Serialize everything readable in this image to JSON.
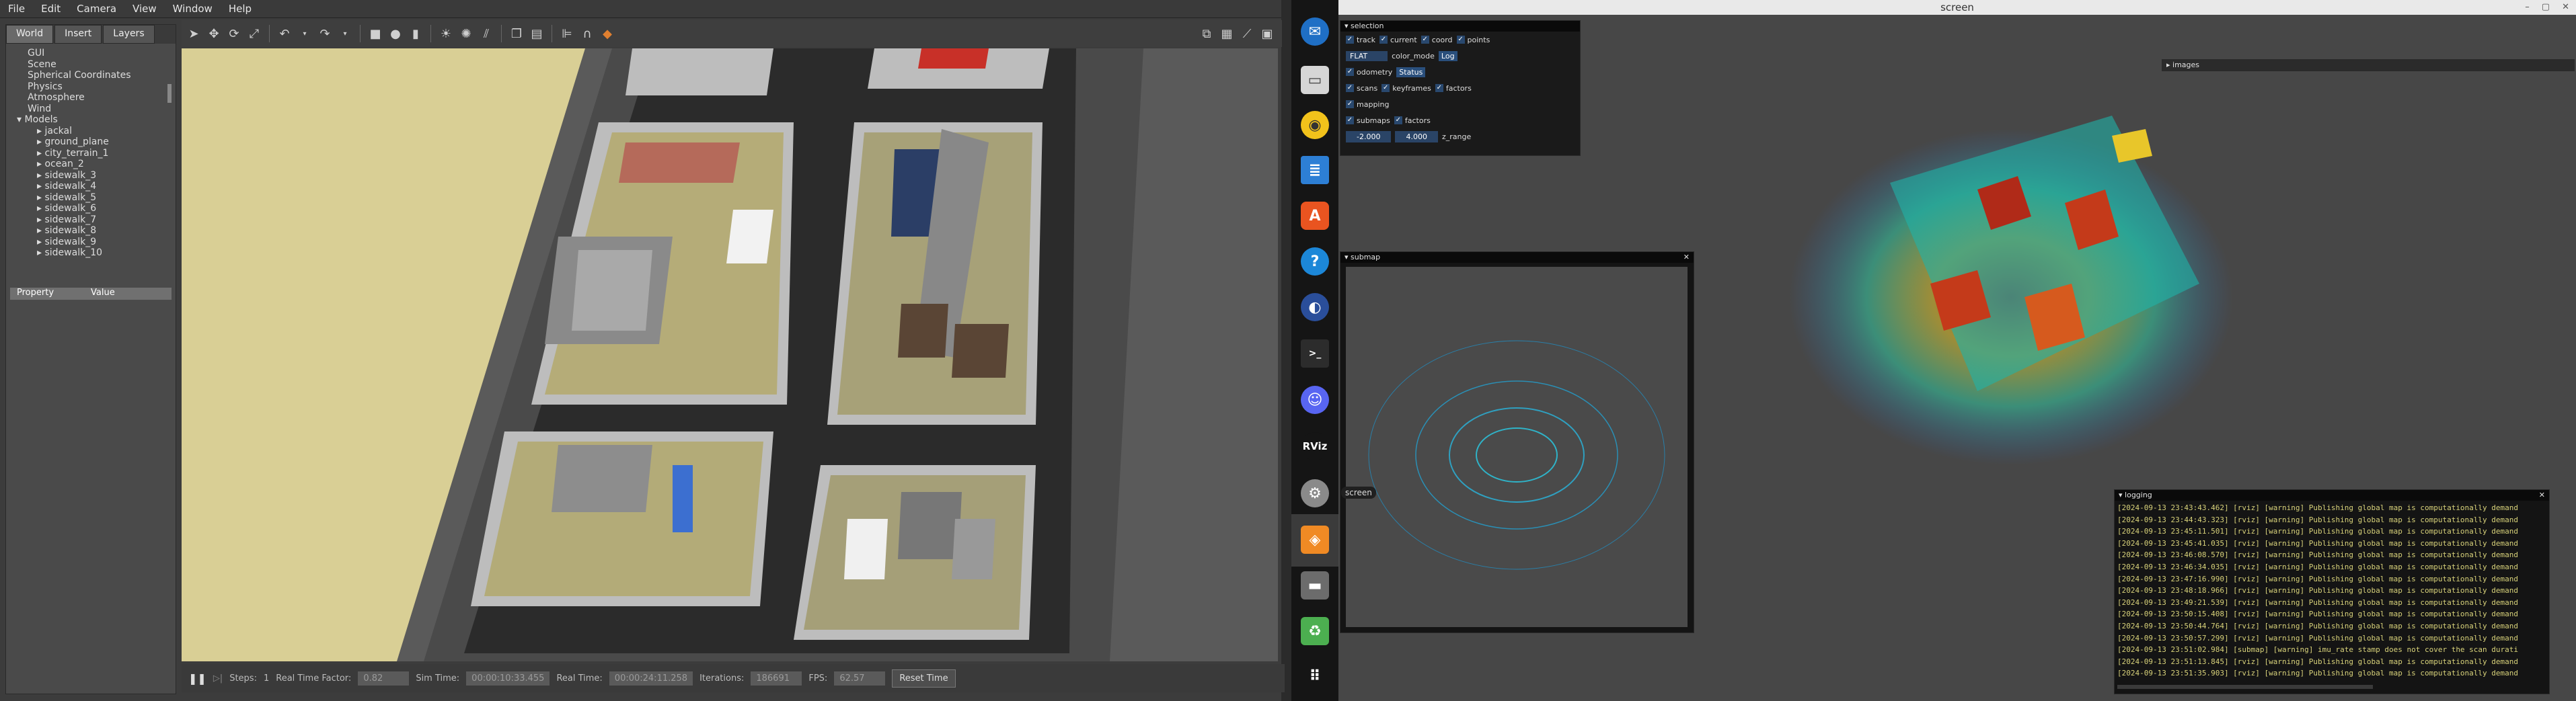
{
  "gazebo": {
    "menu": [
      "File",
      "Edit",
      "Camera",
      "View",
      "Window",
      "Help"
    ],
    "tabs": [
      "World",
      "Insert",
      "Layers"
    ],
    "tree": [
      "GUI",
      "Scene",
      "Spherical Coordinates",
      "Physics",
      "Atmosphere",
      "Wind",
      "Models",
      "jackal",
      "ground_plane",
      "city_terrain_1",
      "ocean_2",
      "sidewalk_3",
      "sidewalk_4",
      "sidewalk_5",
      "sidewalk_6",
      "sidewalk_7",
      "sidewalk_8",
      "sidewalk_9",
      "sidewalk_10"
    ],
    "property_header": {
      "property": "Property",
      "value": "Value"
    },
    "bottom": {
      "steps_label": "Steps:",
      "steps_value": "1",
      "rtf_label": "Real Time Factor:",
      "rtf_value": "0.82",
      "sim_label": "Sim Time:",
      "sim_value": "00:00:10:33.455",
      "real_label": "Real Time:",
      "real_value": "00:00:24:11.258",
      "iter_label": "Iterations:",
      "iter_value": "186691",
      "fps_label": "FPS:",
      "fps_value": "62.57",
      "reset": "Reset Time"
    }
  },
  "rviz": {
    "title": "screen",
    "selection": {
      "title": "selection",
      "row1": [
        "track",
        "current",
        "coord",
        "points"
      ],
      "mode_value": "FLAT",
      "mode_label": "color_mode",
      "log_btn": "Log",
      "odometry": "odometry",
      "status_btn": "Status",
      "row3": [
        "scans",
        "keyframes",
        "factors"
      ],
      "mapping": "mapping",
      "row5": [
        "submaps",
        "factors"
      ],
      "zmin": "-2.000",
      "zmax": "4.000",
      "zlabel": "z_range"
    },
    "images_title": "images",
    "submap_title": "submap",
    "screen_label": "screen",
    "logging": {
      "title": "logging",
      "lines": [
        "[2024-09-13 23:43:43.462] [rviz] [warning] Publishing global map is computationally demand",
        "[2024-09-13 23:44:43.323] [rviz] [warning] Publishing global map is computationally demand",
        "[2024-09-13 23:45:11.501] [rviz] [warning] Publishing global map is computationally demand",
        "[2024-09-13 23:45:41.035] [rviz] [warning] Publishing global map is computationally demand",
        "[2024-09-13 23:46:08.570] [rviz] [warning] Publishing global map is computationally demand",
        "[2024-09-13 23:46:34.035] [rviz] [warning] Publishing global map is computationally demand",
        "[2024-09-13 23:47:16.990] [rviz] [warning] Publishing global map is computationally demand",
        "[2024-09-13 23:48:18.966] [rviz] [warning] Publishing global map is computationally demand",
        "[2024-09-13 23:49:21.539] [rviz] [warning] Publishing global map is computationally demand",
        "[2024-09-13 23:50:15.408] [rviz] [warning] Publishing global map is computationally demand",
        "[2024-09-13 23:50:44.764] [rviz] [warning] Publishing global map is computationally demand",
        "[2024-09-13 23:50:57.299] [rviz] [warning] Publishing global map is computationally demand",
        "[2024-09-13 23:51:02.984] [submap] [warning] imu_rate stamp does not cover the scan durati",
        "[2024-09-13 23:51:13.845] [rviz] [warning] Publishing global map is computationally demand",
        "[2024-09-13 23:51:35.903] [rviz] [warning] Publishing global map is computationally demand"
      ]
    }
  },
  "dock": {
    "icons": [
      "thunderbird-icon",
      "files-icon",
      "rhythmbox-icon",
      "libreoffice-writer-icon",
      "software-icon",
      "help-icon",
      "browser-icon",
      "terminal-icon",
      "discord-icon",
      "rviz-icon",
      "settings-icon",
      "gazebo-icon",
      "drive-icon",
      "trash-icon",
      "apps-grid-icon"
    ],
    "rviz_label": "RViz"
  }
}
